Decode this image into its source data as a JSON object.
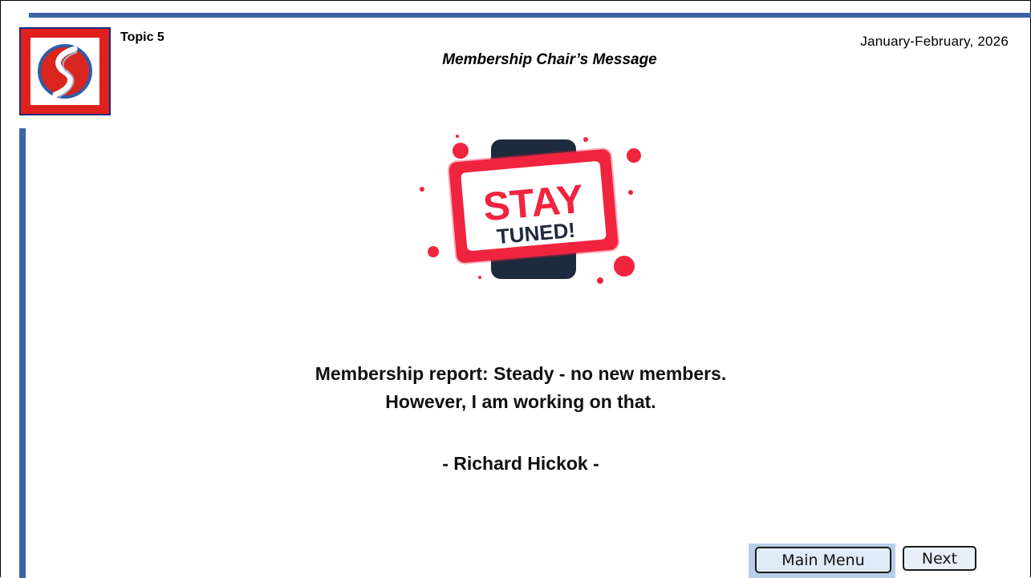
{
  "header": {
    "topic": "Topic 5",
    "date": "January-February,  2026",
    "title": "Membership Chair’s Message"
  },
  "graphic": {
    "line1": "STAY",
    "line2": "TUNED!"
  },
  "body": {
    "report_line1": "Membership report:  Steady - no new members.",
    "report_line2": "However, I am working on that.",
    "signature": "- Richard Hickok -"
  },
  "nav": {
    "main_menu_label": "Main Menu",
    "next_label": "Next"
  },
  "colors": {
    "accent_blue": "#3a64a6",
    "logo_red": "#e0201c",
    "sign_red": "#f0243f",
    "sign_navy": "#1e2a3d"
  }
}
